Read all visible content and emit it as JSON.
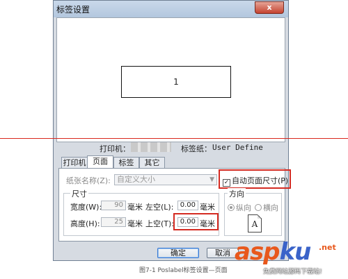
{
  "window": {
    "title": "标签设置",
    "close_glyph": "x"
  },
  "preview": {
    "label_number": "1"
  },
  "info": {
    "printer_label": "打印机：",
    "label_paper_label": "标签纸：",
    "label_paper_value": "User Define"
  },
  "tabs": [
    "打印机",
    "页面",
    "标签",
    "其它"
  ],
  "active_tab": "页面",
  "page": {
    "paper_name_label": "纸张名称(Z):",
    "paper_name_value": "自定义大小",
    "auto_size_label": "自动页面尺寸(P)",
    "auto_size_checked": true,
    "size_group": "尺寸",
    "width_label": "宽度(W):",
    "width_value": "90",
    "height_label": "高度(H):",
    "height_value": "25",
    "unit": "毫米",
    "left_margin_label": "左空(L):",
    "left_margin_value": "0.00",
    "top_margin_label": "上空(T):",
    "top_margin_value": "0.00",
    "orientation_group": "方向",
    "portrait_label": "纵向",
    "landscape_label": "横向",
    "orientation_selected": "纵向",
    "orientation_icon_letter": "A"
  },
  "buttons": {
    "ok": "确定",
    "cancel": "取消"
  },
  "caption": "图7-1 Poslabel标签设置—页面",
  "watermark": {
    "brand_part1": "asp",
    "brand_part2": "ku",
    "suffix": ".net",
    "tagline": "免费网站源码下载站!"
  },
  "colors": {
    "highlight": "#d42a21",
    "accent_blue": "#3a7ad4",
    "watermark_orange": "#e8581c",
    "watermark_blue": "#3a63c9"
  }
}
